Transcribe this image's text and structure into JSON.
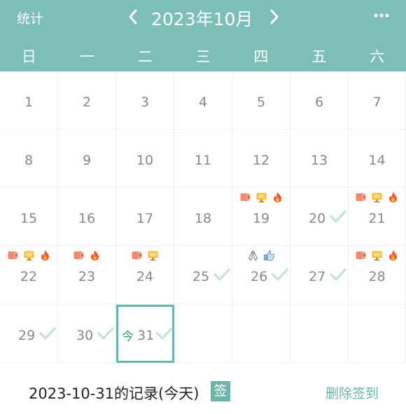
{
  "header": {
    "stats_label": "统计",
    "month_title": "2023年10月",
    "weekdays": [
      "日",
      "一",
      "二",
      "三",
      "四",
      "五",
      "六"
    ],
    "bg_color": "#7cbfb6"
  },
  "calendar": {
    "today_label": "今",
    "days": [
      "1",
      "2",
      "3",
      "4",
      "5",
      "6",
      "7",
      "8",
      "9",
      "10",
      "11",
      "12",
      "13",
      "14",
      "15",
      "16",
      "17",
      "18",
      "19",
      "20",
      "21",
      "22",
      "23",
      "24",
      "25",
      "26",
      "27",
      "28",
      "29",
      "30",
      "31"
    ],
    "checked_days": [
      "20",
      "25",
      "26",
      "27",
      "29",
      "30",
      "31"
    ],
    "today": "31",
    "day_icons": {
      "19": [
        "toilet-paper",
        "monitor",
        "fire"
      ],
      "21": [
        "toilet-paper",
        "monitor",
        "fire"
      ],
      "22": [
        "toilet-paper",
        "monitor",
        "fire"
      ],
      "23": [
        "toilet-paper",
        "fire"
      ],
      "24": [
        "toilet-paper",
        "monitor"
      ],
      "26": [
        "praying-hands",
        "thumbs-up"
      ],
      "28": [
        "toilet-paper",
        "monitor",
        "fire"
      ]
    }
  },
  "footer": {
    "record_title": "2023-10-31的记录(今天)",
    "sign_badge": "签",
    "delete_label": "删除签到"
  },
  "colors": {
    "accent": "#6bb4aa",
    "check": "#c5e3de",
    "day_text": "#888888"
  }
}
